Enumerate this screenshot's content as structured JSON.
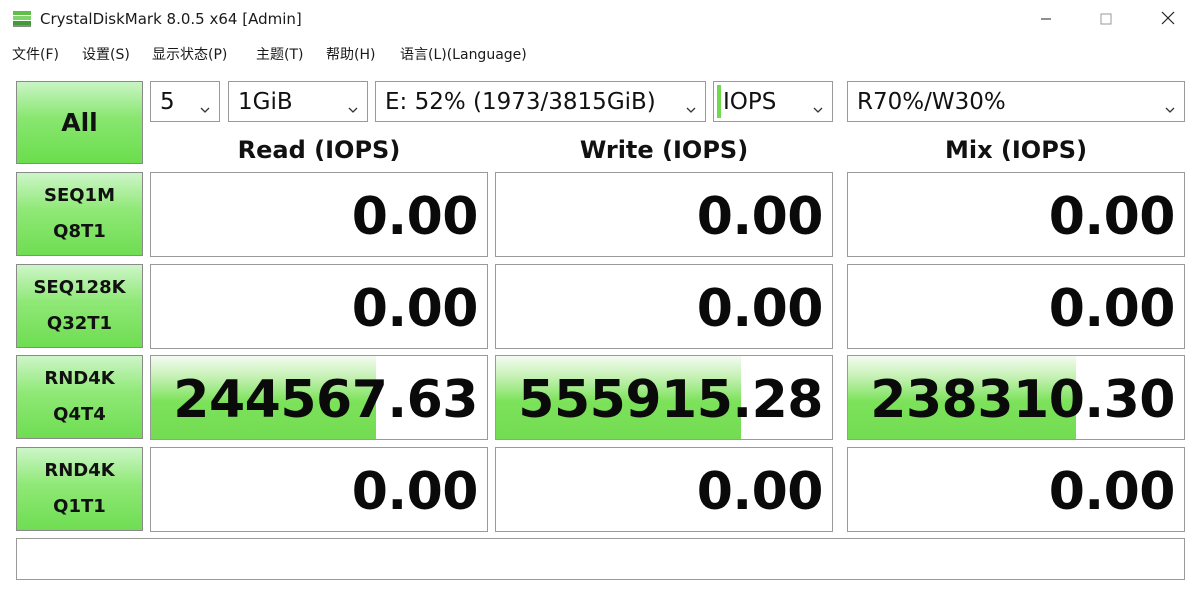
{
  "window": {
    "title": "CrystalDiskMark 8.0.5 x64 [Admin]"
  },
  "menu": [
    {
      "label": "文件(F)"
    },
    {
      "label": "设置(S)"
    },
    {
      "label": "显示状态(P)"
    },
    {
      "label": "主题(T)"
    },
    {
      "label": "帮助(H)"
    },
    {
      "label": "语言(L)(Language)"
    }
  ],
  "controls": {
    "all_label": "All",
    "count": "5",
    "size": "1GiB",
    "drive": "E: 52% (1973/3815GiB)",
    "unit": "IOPS",
    "mix": "R70%/W30%"
  },
  "headers": {
    "read": "Read (IOPS)",
    "write": "Write (IOPS)",
    "mix": "Mix (IOPS)"
  },
  "tests": [
    {
      "line1": "SEQ1M",
      "line2": "Q8T1",
      "read": "0.00",
      "write": "0.00",
      "mix": "0.00",
      "read_level": 0,
      "write_level": 0,
      "mix_level": 0
    },
    {
      "line1": "SEQ128K",
      "line2": "Q32T1",
      "read": "0.00",
      "write": "0.00",
      "mix": "0.00",
      "read_level": 0,
      "write_level": 0,
      "mix_level": 0
    },
    {
      "line1": "RND4K",
      "line2": "Q4T4",
      "read": "244567.63",
      "write": "555915.28",
      "mix": "238310.30",
      "read_level": 0.67,
      "write_level": 0.73,
      "mix_level": 0.68
    },
    {
      "line1": "RND4K",
      "line2": "Q1T1",
      "read": "0.00",
      "write": "0.00",
      "mix": "0.00",
      "read_level": 0,
      "write_level": 0,
      "mix_level": 0
    }
  ],
  "status_text": "",
  "colors": {
    "accent_green": "#6fd94f",
    "bar_green": "#74dc53"
  }
}
